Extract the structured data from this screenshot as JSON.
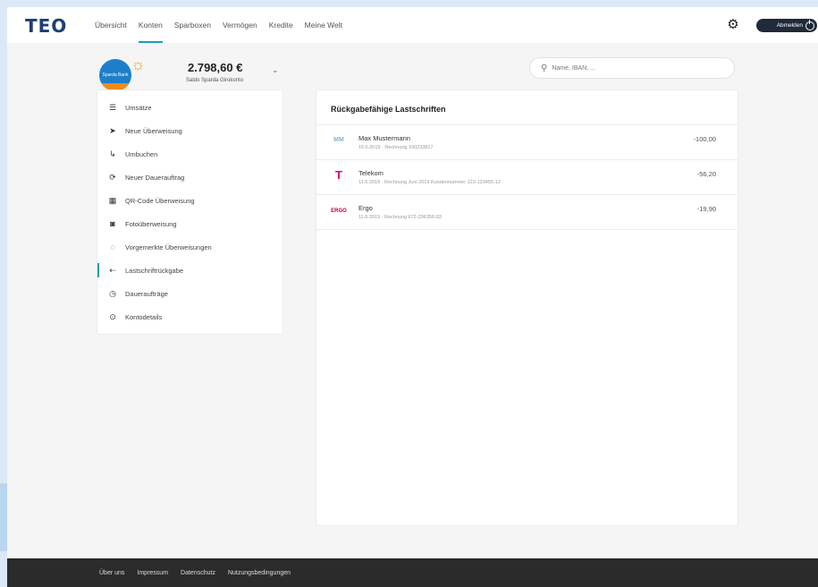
{
  "header": {
    "logo": "TEO",
    "nav": [
      {
        "label": "Übersicht",
        "active": false
      },
      {
        "label": "Konten",
        "active": true
      },
      {
        "label": "Sparboxen",
        "active": false
      },
      {
        "label": "Vermögen",
        "active": false
      },
      {
        "label": "Kredite",
        "active": false
      },
      {
        "label": "Meine Welt",
        "active": false
      }
    ],
    "logout_label": "Abmelden"
  },
  "account": {
    "avatar_text": "Sparda Bank",
    "amount": "2.798,60 €",
    "label": "Saldo Sparda Girokonto"
  },
  "search": {
    "placeholder": "Name, IBAN, ..."
  },
  "sidebar": {
    "items": [
      {
        "label": "Umsätze",
        "icon": "list-icon",
        "glyph": "☰",
        "active": false
      },
      {
        "label": "Neue Überweisung",
        "icon": "send-icon",
        "glyph": "➤",
        "active": false
      },
      {
        "label": "Umbuchen",
        "icon": "transfer-icon",
        "glyph": "↳",
        "active": false
      },
      {
        "label": "Neuer Dauerauftrag",
        "icon": "repeat-icon",
        "glyph": "⟳",
        "active": false
      },
      {
        "label": "QR-Code Überweisung",
        "icon": "qr-code-icon",
        "glyph": "▦",
        "active": false
      },
      {
        "label": "Fotoüberweisung",
        "icon": "camera-icon",
        "glyph": "◙",
        "active": false
      },
      {
        "label": "Vorgemerkte Überweisungen",
        "icon": "pending-icon",
        "glyph": "◌",
        "active": false
      },
      {
        "label": "Lastschriftrückgabe",
        "icon": "return-icon",
        "glyph": "⇠",
        "active": true
      },
      {
        "label": "Daueraufträge",
        "icon": "clock-icon",
        "glyph": "◷",
        "active": false
      },
      {
        "label": "Kontodetails",
        "icon": "info-icon",
        "glyph": "⊙",
        "active": false
      }
    ]
  },
  "main": {
    "title": "Rückgabefähige Lastschriften",
    "rows": [
      {
        "logo": "MM",
        "logo_color": "#7fb6d6",
        "name": "Max Mustermann",
        "desc": "15.6.2019 · Rechnung 100233817",
        "amount": "-100,00"
      },
      {
        "logo": "T",
        "logo_color": "#e20074",
        "name": "Telekom",
        "desc": "11.6.2019 · Rechnung Juni 2019 Kundennummer 123-123455-12",
        "amount": "-56,20"
      },
      {
        "logo": "ERGO",
        "logo_color": "#c3002f",
        "name": "Ergo",
        "desc": "11.6.2019 · Rechnung 672-296356-93",
        "amount": "-19,90"
      }
    ]
  },
  "footer": {
    "links": [
      "Über uns",
      "Impressum",
      "Datenschutz",
      "Nutzungsbedingungen"
    ]
  }
}
